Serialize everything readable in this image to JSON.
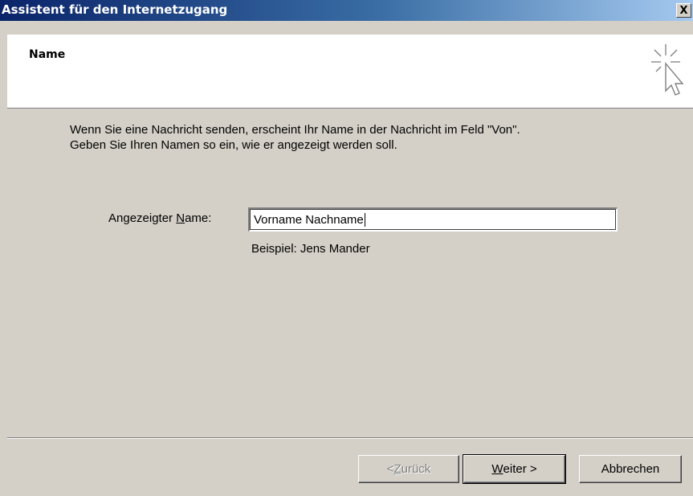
{
  "window": {
    "title": "Assistent für den Internetzugang",
    "close_label": "X"
  },
  "header": {
    "heading": "Name",
    "icon": "wizard-cursor-icon"
  },
  "intro": {
    "line1": "Wenn Sie eine Nachricht senden, erscheint Ihr Name in der Nachricht im Feld \"Von\".",
    "line2": "Geben Sie Ihren Namen so ein, wie er angezeigt werden soll."
  },
  "form": {
    "label_before": "Angezeigter ",
    "label_accel": "N",
    "label_after": "ame:",
    "value": "Vorname Nachname",
    "example": "Beispiel: Jens Mander"
  },
  "buttons": {
    "back": {
      "prefix": "< ",
      "accel": "Z",
      "rest": "urück",
      "disabled": true
    },
    "next": {
      "accel": "W",
      "rest": "eiter >",
      "default": true
    },
    "cancel": {
      "label": "Abbrechen"
    }
  }
}
